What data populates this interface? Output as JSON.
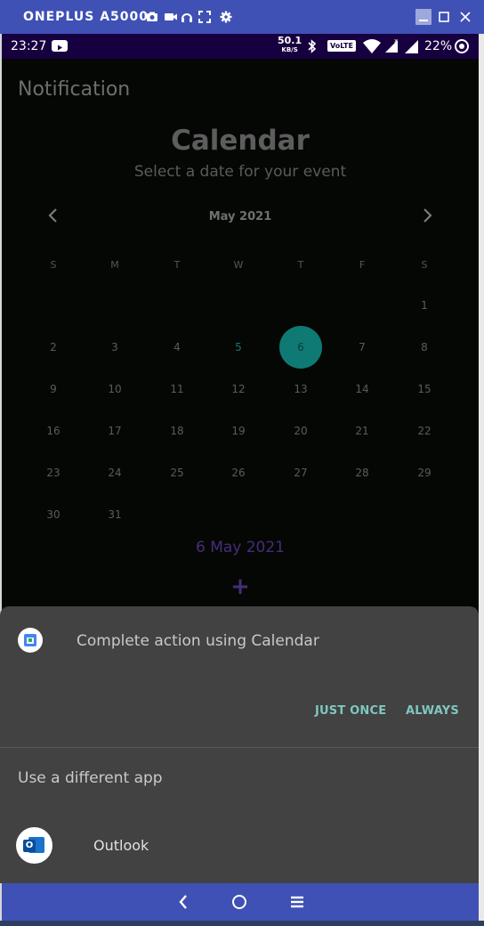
{
  "window": {
    "device_name": "ONEPLUS A5000",
    "icons": [
      "camera-icon",
      "video-icon",
      "headset-icon",
      "fullscreen-icon",
      "settings-icon"
    ],
    "controls": [
      "minimize-icon",
      "maximize-icon",
      "close-icon"
    ]
  },
  "status_bar": {
    "time": "23:27",
    "net_speed": "50.1",
    "net_unit": "KB/S",
    "volte": "VoLTE",
    "battery": "22%"
  },
  "app": {
    "title": "Notification",
    "calendar_title": "Calendar",
    "subtitle": "Select a date for your event",
    "month": "May 2021",
    "weekdays": [
      "S",
      "M",
      "T",
      "W",
      "T",
      "F",
      "S"
    ],
    "weeks": [
      [
        "",
        "",
        "",
        "",
        "",
        "",
        "1"
      ],
      [
        "2",
        "3",
        "4",
        "5",
        "6",
        "7",
        "8"
      ],
      [
        "9",
        "10",
        "11",
        "12",
        "13",
        "14",
        "15"
      ],
      [
        "16",
        "17",
        "18",
        "19",
        "20",
        "21",
        "22"
      ],
      [
        "23",
        "24",
        "25",
        "26",
        "27",
        "28",
        "29"
      ],
      [
        "30",
        "31",
        "",
        "",
        "",
        "",
        ""
      ]
    ],
    "today_day": "5",
    "selected_day": "6",
    "selected_date_text": "6 May 2021",
    "add_symbol": "+"
  },
  "chooser": {
    "title": "Complete action using Calendar",
    "just_once": "JUST ONCE",
    "always": "ALWAYS",
    "different_app": "Use a different app",
    "alt_app": "Outlook"
  },
  "colors": {
    "accent": "#3f51b5",
    "status_bar": "#17003f",
    "selected_circle": "#0e7a73",
    "today_text": "#0e7a73",
    "action_text": "#7fc7c0",
    "selected_date": "#472d78"
  }
}
